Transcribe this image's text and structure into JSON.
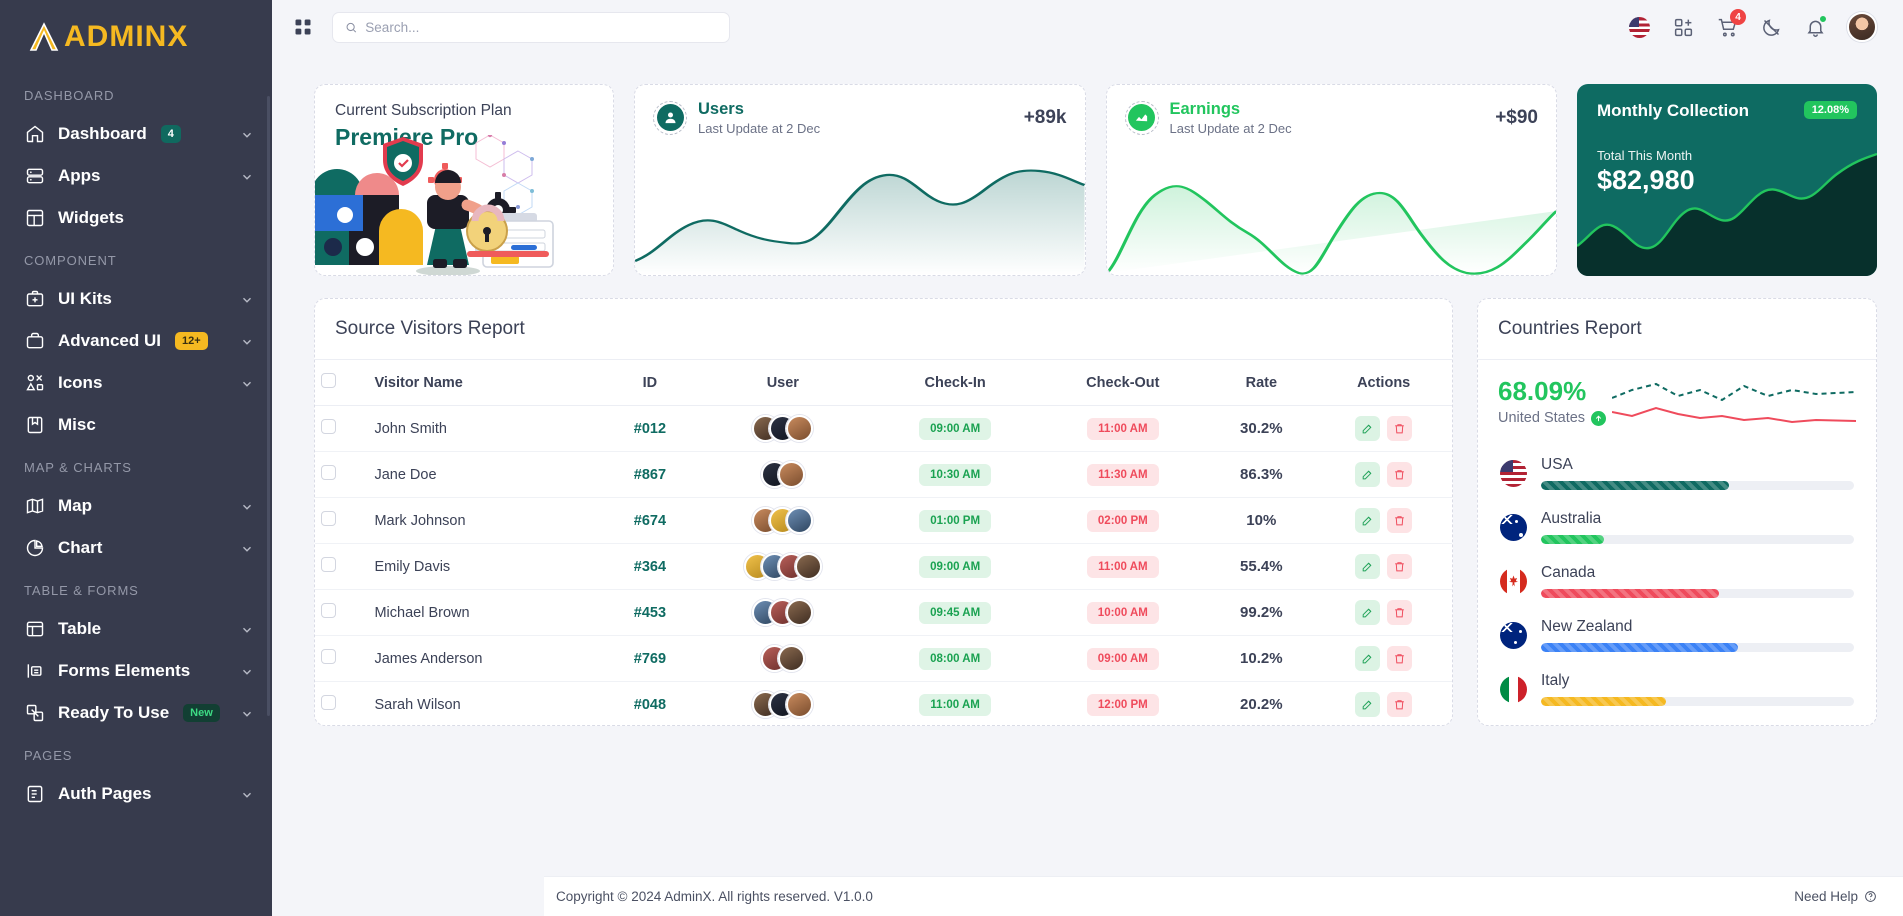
{
  "brand": {
    "name": "ADMINX",
    "accent": "#f5b921"
  },
  "sidebar": {
    "sections": [
      {
        "label": "DASHBOARD",
        "items": [
          {
            "label": "Dashboard",
            "icon": "home-icon",
            "badge": "4",
            "badge_style": "teal",
            "chevron": true
          },
          {
            "label": "Apps",
            "icon": "apps-icon",
            "chevron": true
          },
          {
            "label": "Widgets",
            "icon": "widgets-icon",
            "chevron": false
          }
        ]
      },
      {
        "label": "COMPONENT",
        "items": [
          {
            "label": "UI Kits",
            "icon": "uikit-icon",
            "chevron": true
          },
          {
            "label": "Advanced UI",
            "icon": "briefcase-icon",
            "badge": "12+",
            "badge_style": "yellow",
            "chevron": true
          },
          {
            "label": "Icons",
            "icon": "icons-icon",
            "chevron": true
          },
          {
            "label": "Misc",
            "icon": "misc-icon",
            "chevron": false
          }
        ]
      },
      {
        "label": "MAP & CHARTS",
        "items": [
          {
            "label": "Map",
            "icon": "map-icon",
            "chevron": true
          },
          {
            "label": "Chart",
            "icon": "chart-pie-icon",
            "chevron": true
          }
        ]
      },
      {
        "label": "TABLE & FORMS",
        "items": [
          {
            "label": "Table",
            "icon": "table-icon",
            "chevron": true
          },
          {
            "label": "Forms Elements",
            "icon": "forms-icon",
            "chevron": true
          },
          {
            "label": "Ready To Use",
            "icon": "ready-icon",
            "badge": "New",
            "badge_style": "new",
            "chevron": true
          }
        ]
      },
      {
        "label": "PAGES",
        "items": [
          {
            "label": "Auth Pages",
            "icon": "auth-icon",
            "chevron": true
          }
        ]
      }
    ]
  },
  "topbar": {
    "search_placeholder": "Search...",
    "search_value": "",
    "cart_count": "4",
    "icons": [
      "grid-toggle-icon",
      "flag-us-icon",
      "apps-add-icon",
      "cart-icon",
      "dark-mode-icon",
      "bell-icon",
      "avatar"
    ]
  },
  "cards": {
    "subscription": {
      "label": "Current Subscription Plan",
      "plan": "Premiere Pro"
    },
    "users": {
      "title": "Users",
      "subtitle": "Last Update at 2 Dec",
      "value": "+89k",
      "color": "#0f6b62"
    },
    "earnings": {
      "title": "Earnings",
      "subtitle": "Last Update at 2 Dec",
      "value": "+$90",
      "color": "#22c55e"
    },
    "monthly": {
      "title": "Monthly Collection",
      "percent": "12.08%",
      "total_label": "Total This Month",
      "amount": "$82,980"
    }
  },
  "visitors": {
    "title": "Source Visitors Report",
    "columns": [
      "",
      "Visitor Name",
      "ID",
      "User",
      "Check-In",
      "Check-Out",
      "Rate",
      "Actions"
    ],
    "rows": [
      {
        "name": "John Smith",
        "id": "#012",
        "avatars": 3,
        "checkin": "09:00 AM",
        "checkout": "11:00 AM",
        "rate": "30.2%"
      },
      {
        "name": "Jane Doe",
        "id": "#867",
        "avatars": 2,
        "checkin": "10:30 AM",
        "checkout": "11:30 AM",
        "rate": "86.3%"
      },
      {
        "name": "Mark Johnson",
        "id": "#674",
        "avatars": 3,
        "checkin": "01:00 PM",
        "checkout": "02:00 PM",
        "rate": "10%"
      },
      {
        "name": "Emily Davis",
        "id": "#364",
        "avatars": 4,
        "checkin": "09:00 AM",
        "checkout": "11:00 AM",
        "rate": "55.4%"
      },
      {
        "name": "Michael Brown",
        "id": "#453",
        "avatars": 3,
        "checkin": "09:45 AM",
        "checkout": "10:00 AM",
        "rate": "99.2%"
      },
      {
        "name": "James Anderson",
        "id": "#769",
        "avatars": 2,
        "checkin": "08:00 AM",
        "checkout": "09:00 AM",
        "rate": "10.2%"
      },
      {
        "name": "Sarah Wilson",
        "id": "#048",
        "avatars": 3,
        "checkin": "11:00 AM",
        "checkout": "12:00 PM",
        "rate": "20.2%"
      }
    ],
    "action_labels": {
      "edit": "edit-icon",
      "delete": "delete-icon"
    }
  },
  "countries": {
    "title": "Countries Report",
    "headline_percent": "68.09%",
    "headline_country": "United States",
    "trend": "up",
    "list": [
      {
        "name": "USA",
        "value": 60,
        "color": "#0f6b62"
      },
      {
        "name": "Australia",
        "value": 20,
        "color": "#22c55e"
      },
      {
        "name": "Canada",
        "value": 57,
        "color": "#ef4b5c"
      },
      {
        "name": "New Zealand",
        "value": 63,
        "color": "#3b82f6"
      },
      {
        "name": "Italy",
        "value": 40,
        "color": "#f5b921"
      }
    ]
  },
  "footer": {
    "copyright": "Copyright © 2024 AdminX. All rights reserved. V1.0.0",
    "help": "Need Help"
  },
  "chart_data": [
    {
      "type": "area",
      "name": "users-sparkline",
      "x": [
        0,
        1,
        2,
        3,
        4,
        5,
        6,
        7,
        8,
        9,
        10
      ],
      "values": [
        12,
        20,
        46,
        38,
        34,
        30,
        18,
        62,
        52,
        68,
        58
      ],
      "color": "#0f6b62",
      "fill": "rgba(15,107,98,0.18)",
      "ylim": [
        0,
        80
      ]
    },
    {
      "type": "area",
      "name": "earnings-sparkline",
      "x": [
        0,
        1,
        2,
        3,
        4,
        5,
        6,
        7,
        8,
        9,
        10
      ],
      "values": [
        8,
        34,
        56,
        48,
        30,
        14,
        24,
        60,
        38,
        54,
        26
      ],
      "color": "#22c55e",
      "fill": "rgba(34,197,94,0.16)",
      "ylim": [
        0,
        70
      ]
    },
    {
      "type": "area",
      "name": "monthly-collection-sparkline",
      "x": [
        0,
        1,
        2,
        3,
        4,
        5,
        6,
        7,
        8,
        9,
        10
      ],
      "values": [
        18,
        30,
        22,
        40,
        34,
        30,
        48,
        40,
        56,
        50,
        70
      ],
      "color": "#22c55e",
      "fill": "#07302c",
      "ylim": [
        0,
        80
      ]
    },
    {
      "type": "line",
      "name": "countries-sparkline",
      "series": [
        {
          "name": "dashed-top",
          "values": [
            30,
            44,
            52,
            40,
            46,
            38,
            52,
            44,
            50,
            46
          ],
          "color": "#0f6b62",
          "style": "dashed"
        },
        {
          "name": "solid-red",
          "values": [
            18,
            14,
            22,
            16,
            12,
            14,
            10,
            12,
            9,
            11
          ],
          "color": "#ef4b5c",
          "style": "solid"
        }
      ],
      "ylim": [
        0,
        60
      ]
    }
  ]
}
